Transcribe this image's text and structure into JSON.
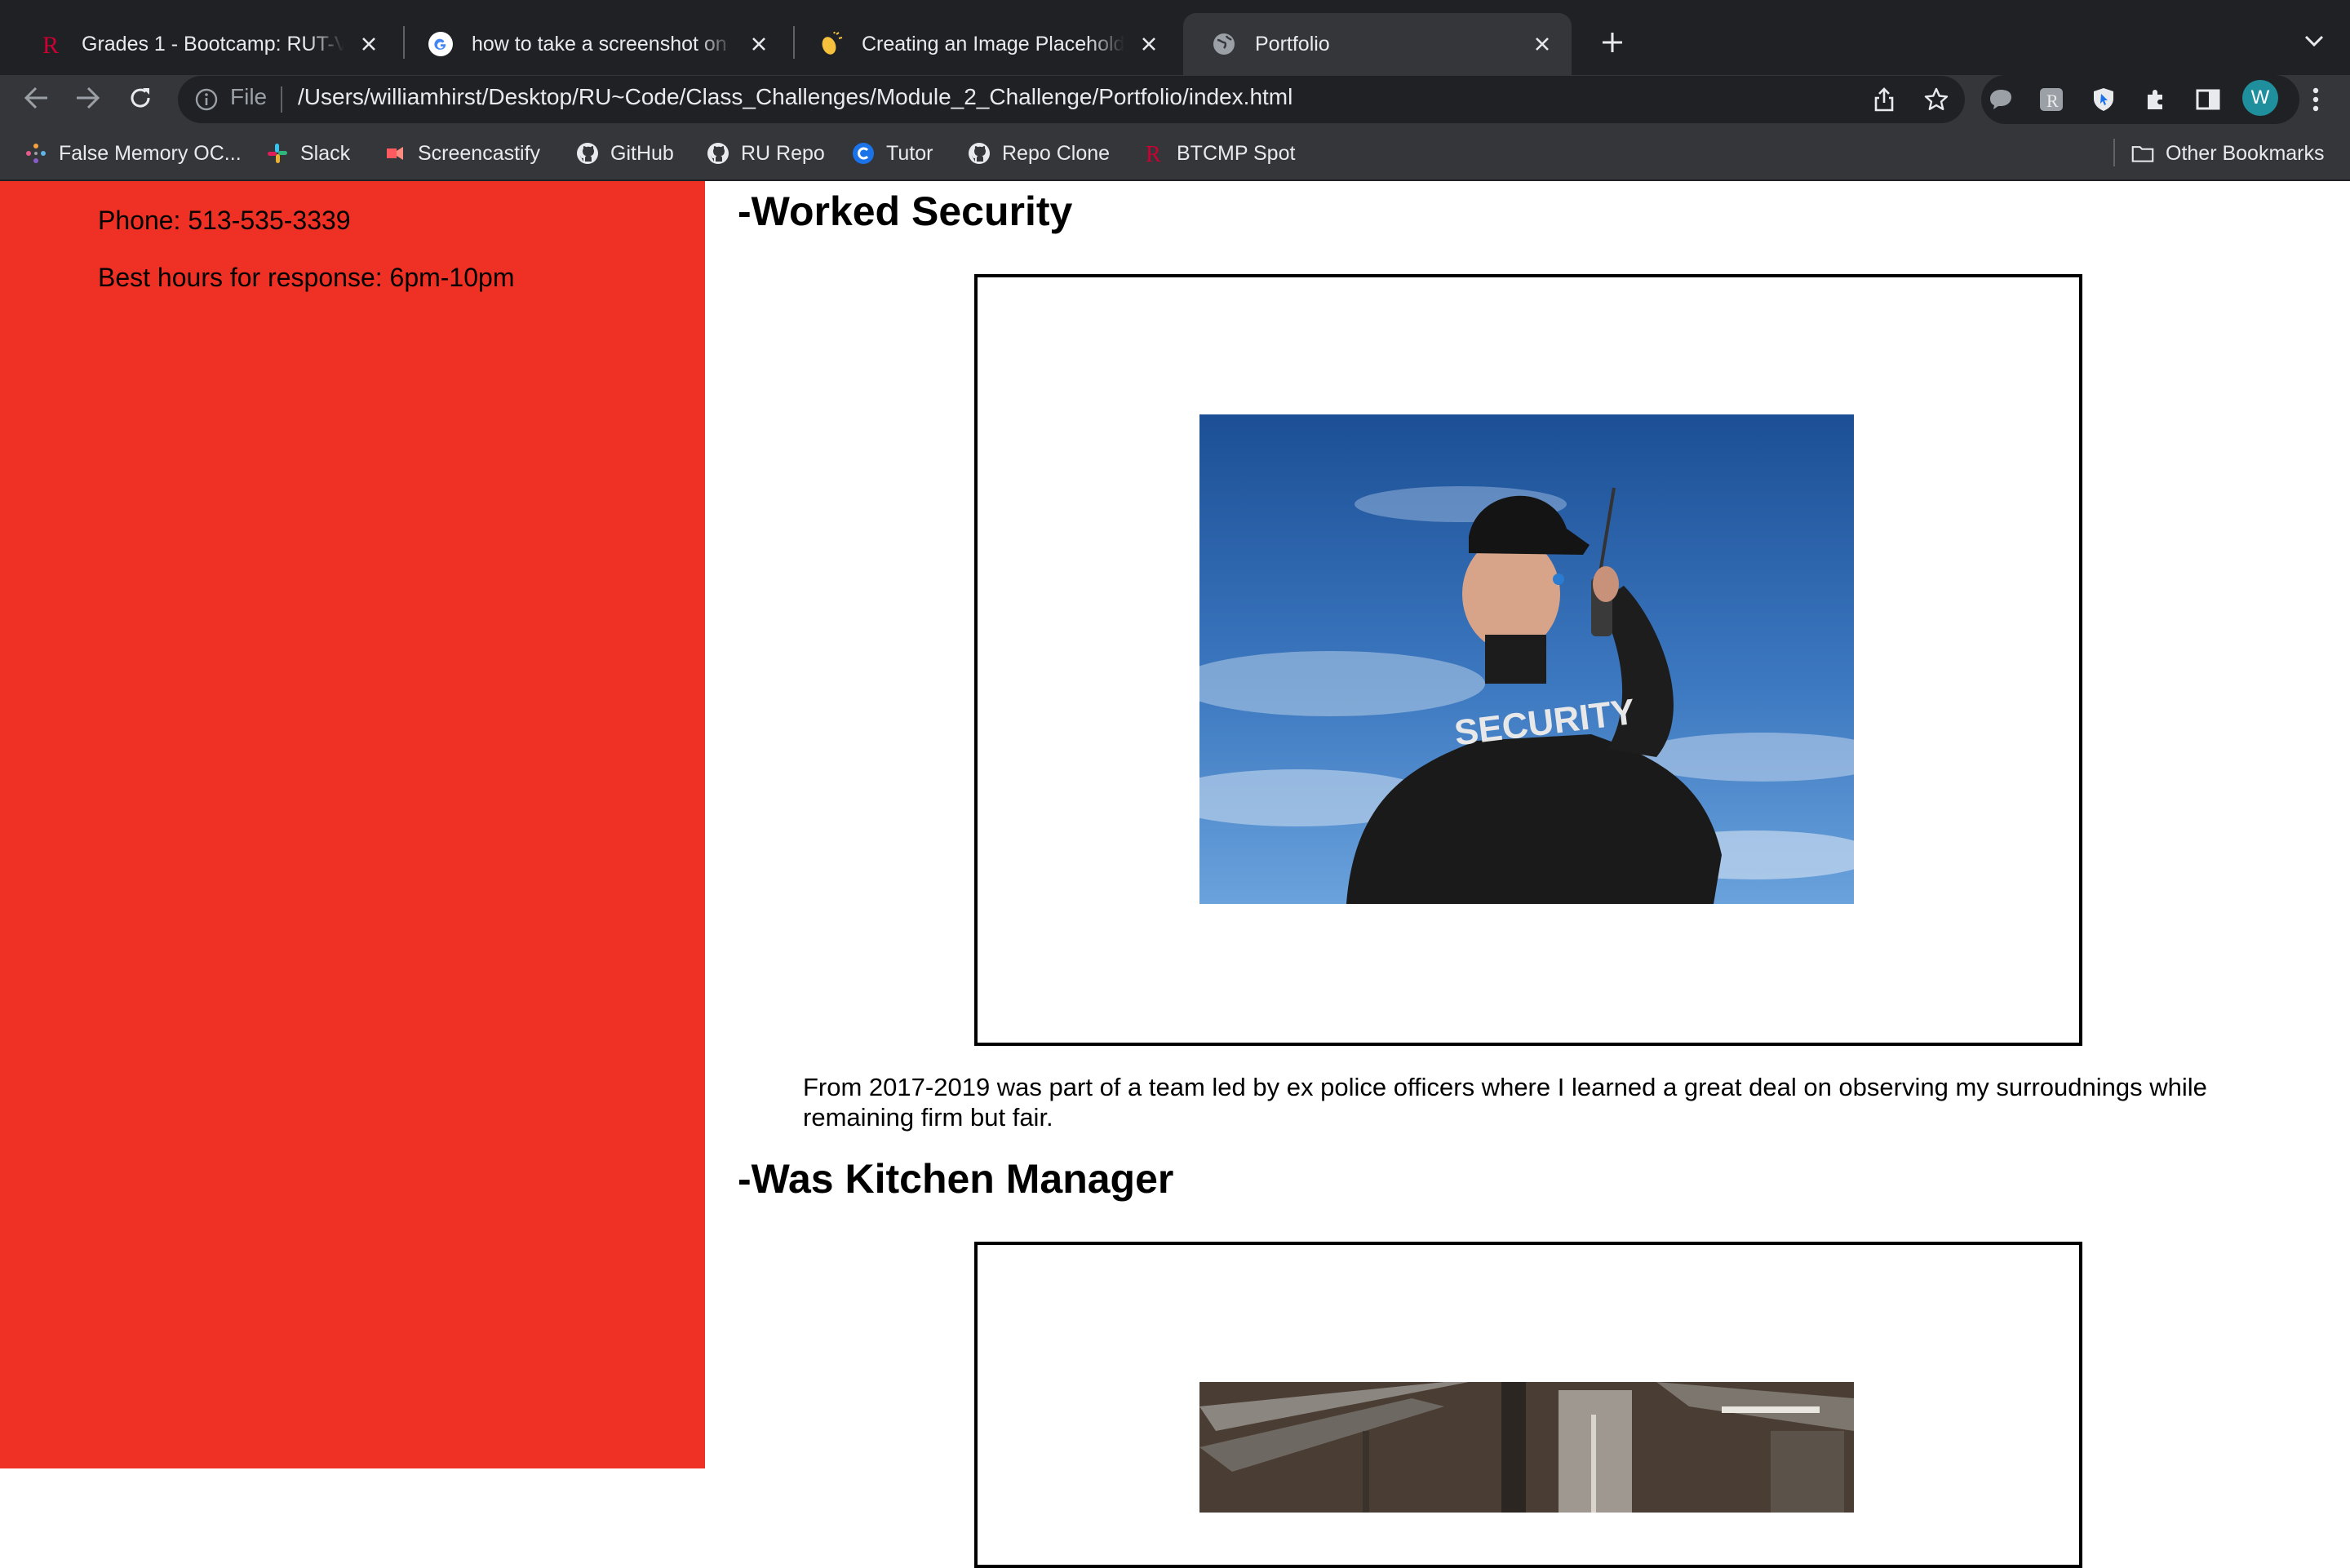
{
  "browser": {
    "tabs": [
      {
        "title": "Grades 1 - Bootcamp: RUT-VIRT",
        "icon": "rutgers-r-icon",
        "active": false
      },
      {
        "title": "how to take a screenshot on mac",
        "icon": "google-icon",
        "active": false
      },
      {
        "title": "Creating an Image Placeholder",
        "icon": "clapping-hands-icon",
        "active": false
      },
      {
        "title": "Portfolio",
        "icon": "globe-icon",
        "active": true
      }
    ],
    "address_bar": {
      "scheme_label": "File",
      "url": "/Users/williamhirst/Desktop/RU~Code/Class_Challenges/Module_2_Challenge/Portfolio/index.html"
    },
    "profile_initial": "W",
    "bookmarks": [
      {
        "label": "False Memory OC...",
        "icon": "dots-grid-icon"
      },
      {
        "label": "Slack",
        "icon": "slack-icon"
      },
      {
        "label": "Screencastify",
        "icon": "screencastify-icon"
      },
      {
        "label": "GitHub",
        "icon": "github-icon"
      },
      {
        "label": "RU Repo",
        "icon": "github-icon"
      },
      {
        "label": "Tutor",
        "icon": "tutor-icon"
      },
      {
        "label": "Repo Clone",
        "icon": "github-icon"
      },
      {
        "label": "BTCMP Spot",
        "icon": "rutgers-r-icon"
      }
    ],
    "other_bookmarks": "Other Bookmarks"
  },
  "page": {
    "sidebar": {
      "phone": "Phone: 513-535-3339",
      "hours": "Best hours for response: 6pm-10pm"
    },
    "sections": [
      {
        "heading": "-Worked Security",
        "image_text": "SECURITY",
        "description": "From 2017-2019 was part of a team led by ex police officers where I learned a great deal on observing my surroudnings while remaining firm but fair."
      },
      {
        "heading": "-Was Kitchen Manager"
      }
    ]
  },
  "colors": {
    "sidebar_bg": "#ee3124",
    "tabstrip_bg": "#202124",
    "toolbar_bg": "#35363a",
    "sky_blue": "#2f6bb3"
  }
}
